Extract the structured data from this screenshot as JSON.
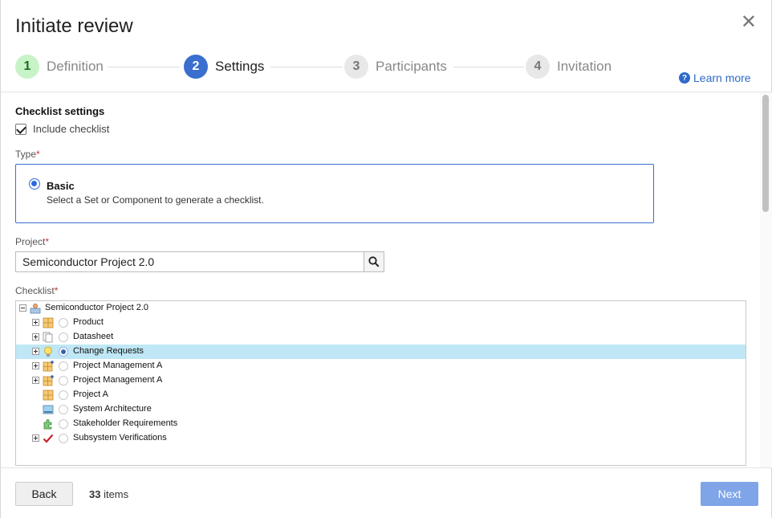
{
  "dialog": {
    "title": "Initiate review",
    "close_glyph": "✕",
    "learn_more": "Learn more"
  },
  "steps": [
    {
      "num": "1",
      "label": "Definition",
      "state": "done"
    },
    {
      "num": "2",
      "label": "Settings",
      "state": "active"
    },
    {
      "num": "3",
      "label": "Participants",
      "state": "todo"
    },
    {
      "num": "4",
      "label": "Invitation",
      "state": "todo"
    }
  ],
  "checklist_settings": {
    "title": "Checklist settings",
    "include_label": "Include checklist",
    "include_checked": true
  },
  "type": {
    "label": "Type",
    "required_mark": "*",
    "option_name": "Basic",
    "option_desc": "Select a Set or Component to generate a checklist."
  },
  "project": {
    "label": "Project",
    "required_mark": "*",
    "value": "Semiconductor Project 2.0"
  },
  "checklist": {
    "label": "Checklist",
    "required_mark": "*",
    "root": "Semiconductor Project 2.0",
    "items": [
      {
        "label": "Product",
        "icon": "grid-icon",
        "expandable": true,
        "selected": false
      },
      {
        "label": "Datasheet",
        "icon": "documents-icon",
        "expandable": true,
        "selected": false
      },
      {
        "label": "Change Requests",
        "icon": "lightbulb-icon",
        "expandable": true,
        "selected": true
      },
      {
        "label": "Project Management A",
        "icon": "grid-dot-icon",
        "expandable": true,
        "selected": false
      },
      {
        "label": "Project Management A",
        "icon": "grid-dot-icon",
        "expandable": true,
        "selected": false
      },
      {
        "label": "Project A",
        "icon": "grid-icon",
        "expandable": false,
        "selected": false
      },
      {
        "label": "System Architecture",
        "icon": "image-icon",
        "expandable": false,
        "selected": false
      },
      {
        "label": "Stakeholder Requirements",
        "icon": "puzzle-icon",
        "expandable": false,
        "selected": false
      },
      {
        "label": "Subsystem Verifications",
        "icon": "checkmark-icon",
        "expandable": true,
        "selected": false
      }
    ]
  },
  "footer": {
    "back": "Back",
    "count": "33",
    "count_suffix": " items",
    "next": "Next"
  },
  "colors": {
    "accent": "#3a6fcf",
    "done_step": "#c8f3c8",
    "selected_row": "#bfe7f5",
    "next_disabled": "#7fa4e8"
  }
}
